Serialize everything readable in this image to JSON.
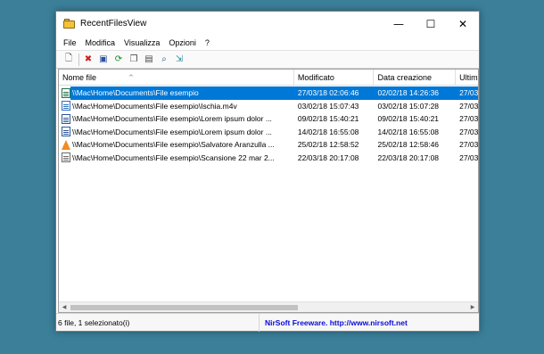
{
  "window": {
    "title": "RecentFilesView",
    "minimize_glyph": "—",
    "maximize_glyph": "☐",
    "close_glyph": "✕"
  },
  "menu": [
    "File",
    "Modifica",
    "Visualizza",
    "Opzioni",
    "?"
  ],
  "toolbar": {
    "buttons": [
      {
        "name": "properties-icon",
        "glyph": "🗋",
        "color": "#4a4a4a"
      },
      {
        "name": "delete-icon",
        "glyph": "✖",
        "color": "#d11f1f"
      },
      {
        "name": "save-icon",
        "glyph": "▣",
        "color": "#2d4f9e"
      },
      {
        "name": "refresh-icon",
        "glyph": "⟳",
        "color": "#1a8a2a"
      },
      {
        "name": "copy-icon",
        "glyph": "❐",
        "color": "#4a4a4a"
      },
      {
        "name": "html-report-icon",
        "glyph": "▤",
        "color": "#4a4a4a"
      },
      {
        "name": "find-icon",
        "glyph": "⌕",
        "color": "#2d4f9e"
      },
      {
        "name": "exit-icon",
        "glyph": "⇲",
        "color": "#1a8a9a"
      }
    ]
  },
  "columns": [
    "Nome file",
    "Modificato",
    "Data creazione",
    "Ultim"
  ],
  "sort_arrow": "^",
  "rows": [
    {
      "icon": "excel-file-icon",
      "icon_color": "#1e7145",
      "name": "\\\\Mac\\Home\\Documents\\File esempio",
      "modified": "27/03/18 02:06:46",
      "created": "02/02/18 14:26:36",
      "last": "27/03",
      "selected": true
    },
    {
      "icon": "video-file-icon",
      "icon_color": "#2f6ebf",
      "name": "\\\\Mac\\Home\\Documents\\File esempio\\Ischia.m4v",
      "modified": "03/02/18 15:07:43",
      "created": "03/02/18 15:07:28",
      "last": "27/03",
      "selected": false
    },
    {
      "icon": "word-file-icon",
      "icon_color": "#2b579a",
      "name": "\\\\Mac\\Home\\Documents\\File esempio\\Lorem ipsum dolor ...",
      "modified": "09/02/18 15:40:21",
      "created": "09/02/18 15:40:21",
      "last": "27/03",
      "selected": false
    },
    {
      "icon": "word-file-icon",
      "icon_color": "#2b579a",
      "name": "\\\\Mac\\Home\\Documents\\File esempio\\Lorem ipsum dolor ...",
      "modified": "14/02/18 16:55:08",
      "created": "14/02/18 16:55:08",
      "last": "27/03",
      "selected": false
    },
    {
      "icon": "vlc-cone-icon",
      "icon_color": "#f28c1e",
      "name": "\\\\Mac\\Home\\Documents\\File esempio\\Salvatore Aranzulla ...",
      "modified": "25/02/18 12:58:52",
      "created": "25/02/18 12:58:46",
      "last": "27/03",
      "selected": false
    },
    {
      "icon": "text-file-icon",
      "icon_color": "#6b6b6b",
      "name": "\\\\Mac\\Home\\Documents\\File esempio\\Scansione 22 mar 2...",
      "modified": "22/03/18 20:17:08",
      "created": "22/03/18 20:17:08",
      "last": "27/03",
      "selected": false
    }
  ],
  "scroll": {
    "left": "◀",
    "right": "▶"
  },
  "status": {
    "count": "6 file, 1 selezionato(i)",
    "credit": "NirSoft Freeware.  http://www.nirsoft.net"
  }
}
